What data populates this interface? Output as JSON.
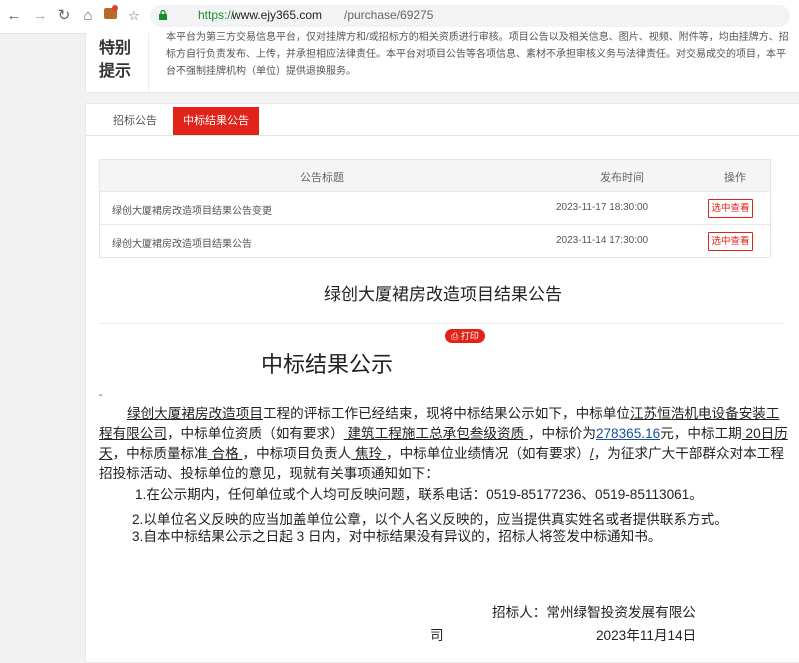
{
  "browser": {
    "url_scheme": "https://",
    "url_host": "www.ejy365.com",
    "url_path": "/purchase/69275"
  },
  "notice": {
    "title": "特别提示",
    "text": "本平台为第三方交易信息平台，仅对挂牌方和/或招标方的相关资质进行审核。项目公告以及相关信息、图片、视频、附件等，均由挂牌方、招标方自行负责发布、上传，并承担相应法律责任。本平台对项目公告等各项信息、素材不承担审核义务与法律责任。对交易成交的项目，本平台不强制挂牌机构（单位）提供退换服务。"
  },
  "tabs": [
    {
      "label": "招标公告"
    },
    {
      "label": "中标结果公告"
    }
  ],
  "table": {
    "headers": {
      "title": "公告标题",
      "time": "发布时间",
      "op": "操作"
    },
    "rows": [
      {
        "title": "绿创大厦裙房改造项目结果公告变更",
        "time": "2023-11-17 18:30:00",
        "action": "选中查看"
      },
      {
        "title": "绿创大厦裙房改造项目结果公告",
        "time": "2023-11-14 17:30:00",
        "action": "选中查看"
      }
    ]
  },
  "document": {
    "title": "绿创大厦裙房改造项目结果公告",
    "print_label": "打印",
    "heading": "中标结果公示",
    "dash": "-",
    "p1_project": "绿创大厦裙房改造项目",
    "p1_a": "工程的评标工作已经结束，现将中标结果公示如下，中标单位",
    "p1_winner": "江苏恒浩机电设备安装工程有限公司",
    "p1_b": "，中标单位资质（如有要求）",
    "p1_qual": " 建筑工程施工总承包叁级资质 ",
    "p1_c": "，中标价为",
    "p1_price": "278365.16",
    "p1_d": "元，中标工期",
    "p1_period": " 20日历天",
    "p1_e": "，中标质量标准",
    "p1_quality": " 合格 ",
    "p1_f": "，中标项目负责人",
    "p1_manager": " 焦玲 ",
    "p1_g": "，中标单位业绩情况（如有要求）",
    "p1_perf": "/",
    "p1_h": "，为征求广大干部群众对本工程招投标活动、投标单位的意见，现就有关事项通知如下：",
    "item1": "1.在公示期内，任何单位或个人均可反映问题，联系电话：0519-85177236、0519-85113061。",
    "item2": "2.以单位名义反映的应当加盖单位公章，以个人名义反映的，应当提供真实姓名或者提供联系方式。",
    "item3": "3.自本中标结果公示之日起 3 日内，对中标结果没有异议的，招标人将签发中标通知书。",
    "sign_line1": "招标人：常州绿智投资发展有限公",
    "sign_line2": "司",
    "sign_date": "2023年11月14日"
  }
}
